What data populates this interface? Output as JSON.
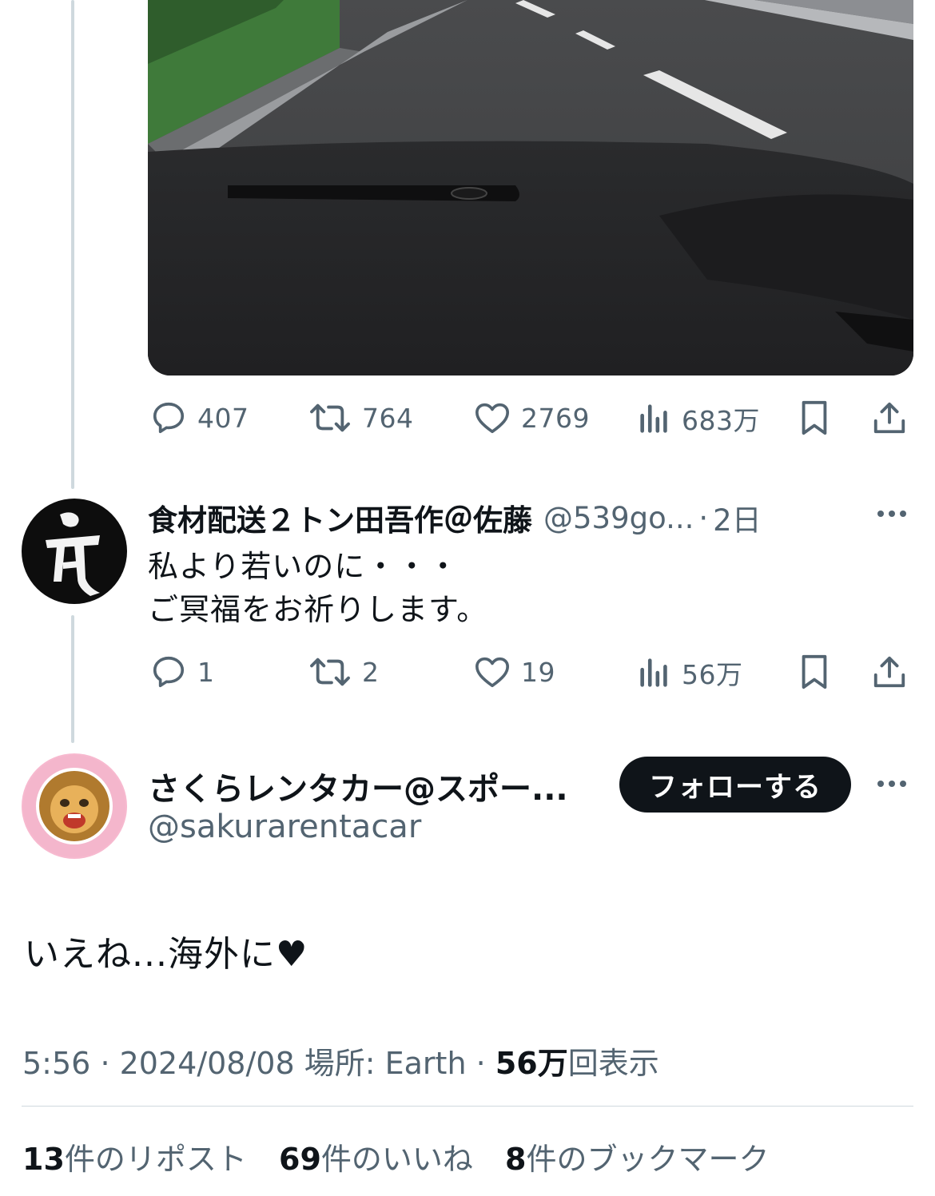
{
  "colors": {
    "text": "#0f1419",
    "secondary": "#536471",
    "line": "#cfd9de",
    "button": "#0f1419"
  },
  "previous_tweet": {
    "actions": {
      "replies": "407",
      "reposts": "764",
      "likes": "2769",
      "views": "683万"
    }
  },
  "reply": {
    "display_name": "食材配送２トン田吾作＠佐藤",
    "handle": "@539go...",
    "separator": "·",
    "age": "2日",
    "lines": [
      "私より若いのに・・・",
      "ご冥福をお祈りします。"
    ],
    "actions": {
      "replies": "1",
      "reposts": "2",
      "likes": "19",
      "views": "56万"
    }
  },
  "main_tweet": {
    "display_name": "さくらレンタカー@スポー...",
    "handle": "@sakurarentacar",
    "follow_label": "フォローする",
    "text": "いえね...海外に♥",
    "time": "5:56",
    "separator": "·",
    "date": "2024/08/08",
    "location": "場所: Earth",
    "views_count": "56万",
    "views_label": "回表示",
    "stats": {
      "reposts_count": "13",
      "reposts_label": "件のリポスト",
      "likes_count": "69",
      "likes_label": "件のいいね",
      "bookmarks_count": "8",
      "bookmarks_label": "件のブックマーク"
    }
  },
  "icons": [
    "reply-icon",
    "repost-icon",
    "like-icon",
    "views-icon",
    "bookmark-icon",
    "share-icon",
    "more-icon"
  ]
}
